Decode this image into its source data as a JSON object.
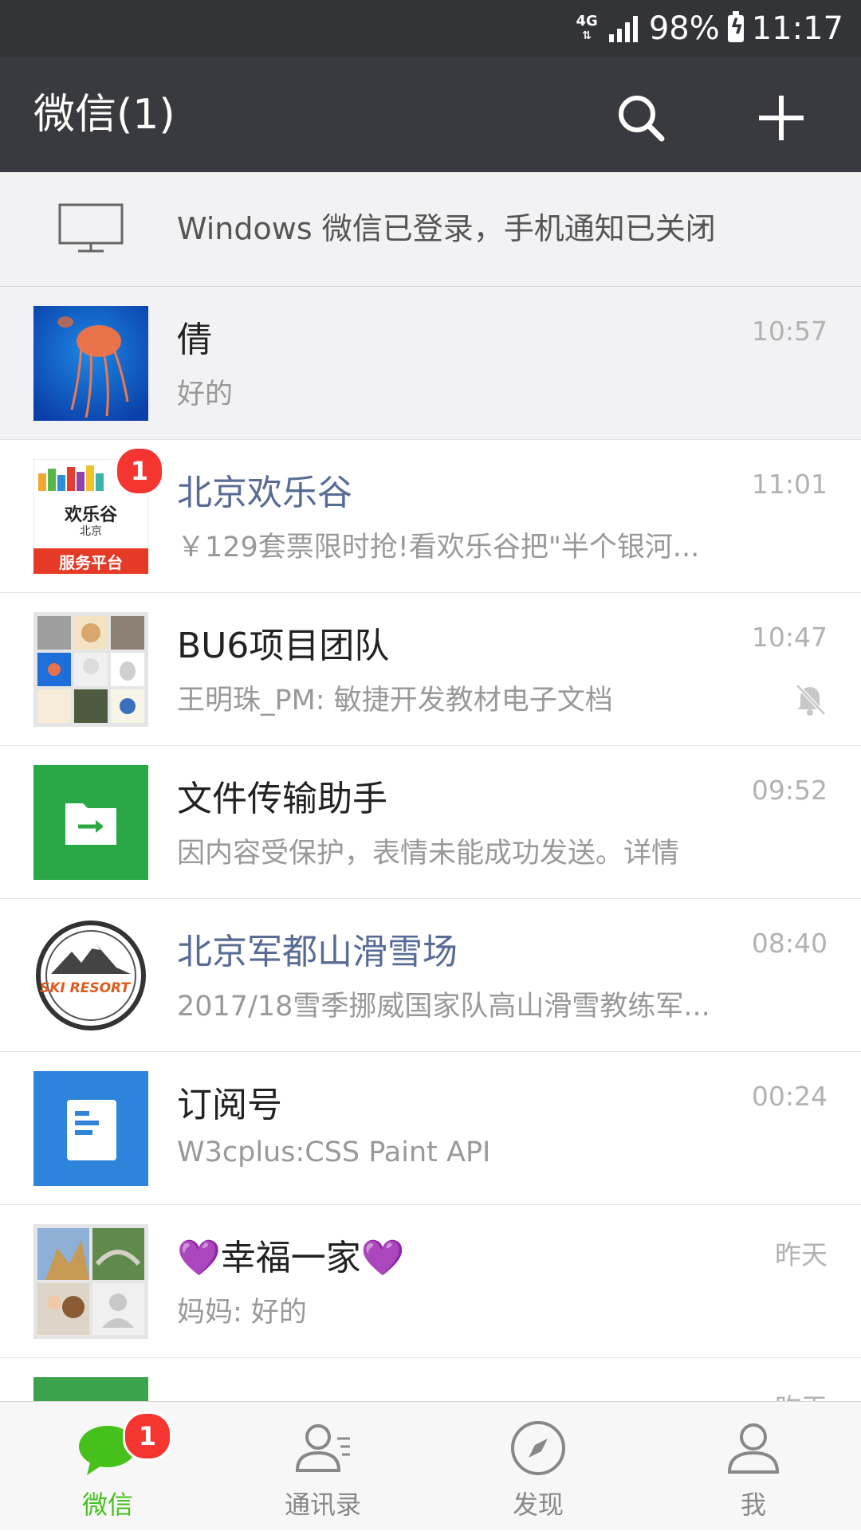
{
  "status_bar": {
    "network": "4G",
    "battery": "98%",
    "time": "11:17"
  },
  "header": {
    "title": "微信(1)",
    "search_icon": "search-icon",
    "add_icon": "plus-icon"
  },
  "notice": {
    "text": "Windows 微信已登录，手机通知已关闭",
    "icon": "monitor-icon"
  },
  "chats": [
    {
      "name": "倩",
      "preview": "好的",
      "time": "10:57"
    },
    {
      "name": "北京欢乐谷",
      "preview": "￥129套票限时抢!看欢乐谷把\"半个银河...",
      "time": "11:01",
      "badge": "1",
      "avatar_text_top": "欢乐谷",
      "avatar_text_mid": "北京",
      "avatar_text_bottom": "服务平台"
    },
    {
      "name": "BU6项目团队",
      "preview": "王明珠_PM: 敏捷开发教材电子文档",
      "time": "10:47"
    },
    {
      "name": "文件传输助手",
      "preview": "因内容受保护，表情未能成功发送。详情",
      "time": "09:52"
    },
    {
      "name": "北京军都山滑雪场",
      "preview": "2017/18雪季挪威国家队高山滑雪教练军...",
      "time": "08:40",
      "avatar_text": "SKI RESORT"
    },
    {
      "name": "订阅号",
      "preview": "W3cplus:CSS Paint API",
      "time": "00:24"
    },
    {
      "name": "💜幸福一家💜",
      "preview": "妈妈: 好的",
      "time": "昨天"
    },
    {
      "name": "",
      "preview": "",
      "time": "昨天"
    }
  ],
  "tabs": [
    {
      "label": "微信",
      "icon": "chat-bubble-icon",
      "badge": "1"
    },
    {
      "label": "通讯录",
      "icon": "contacts-icon"
    },
    {
      "label": "发现",
      "icon": "compass-icon"
    },
    {
      "label": "我",
      "icon": "person-icon"
    }
  ],
  "colors": {
    "header_bg": "#393a3f",
    "status_bg": "#333438",
    "accent_green": "#46c11b",
    "link_blue": "#576b95",
    "badge_red": "#f43530"
  }
}
